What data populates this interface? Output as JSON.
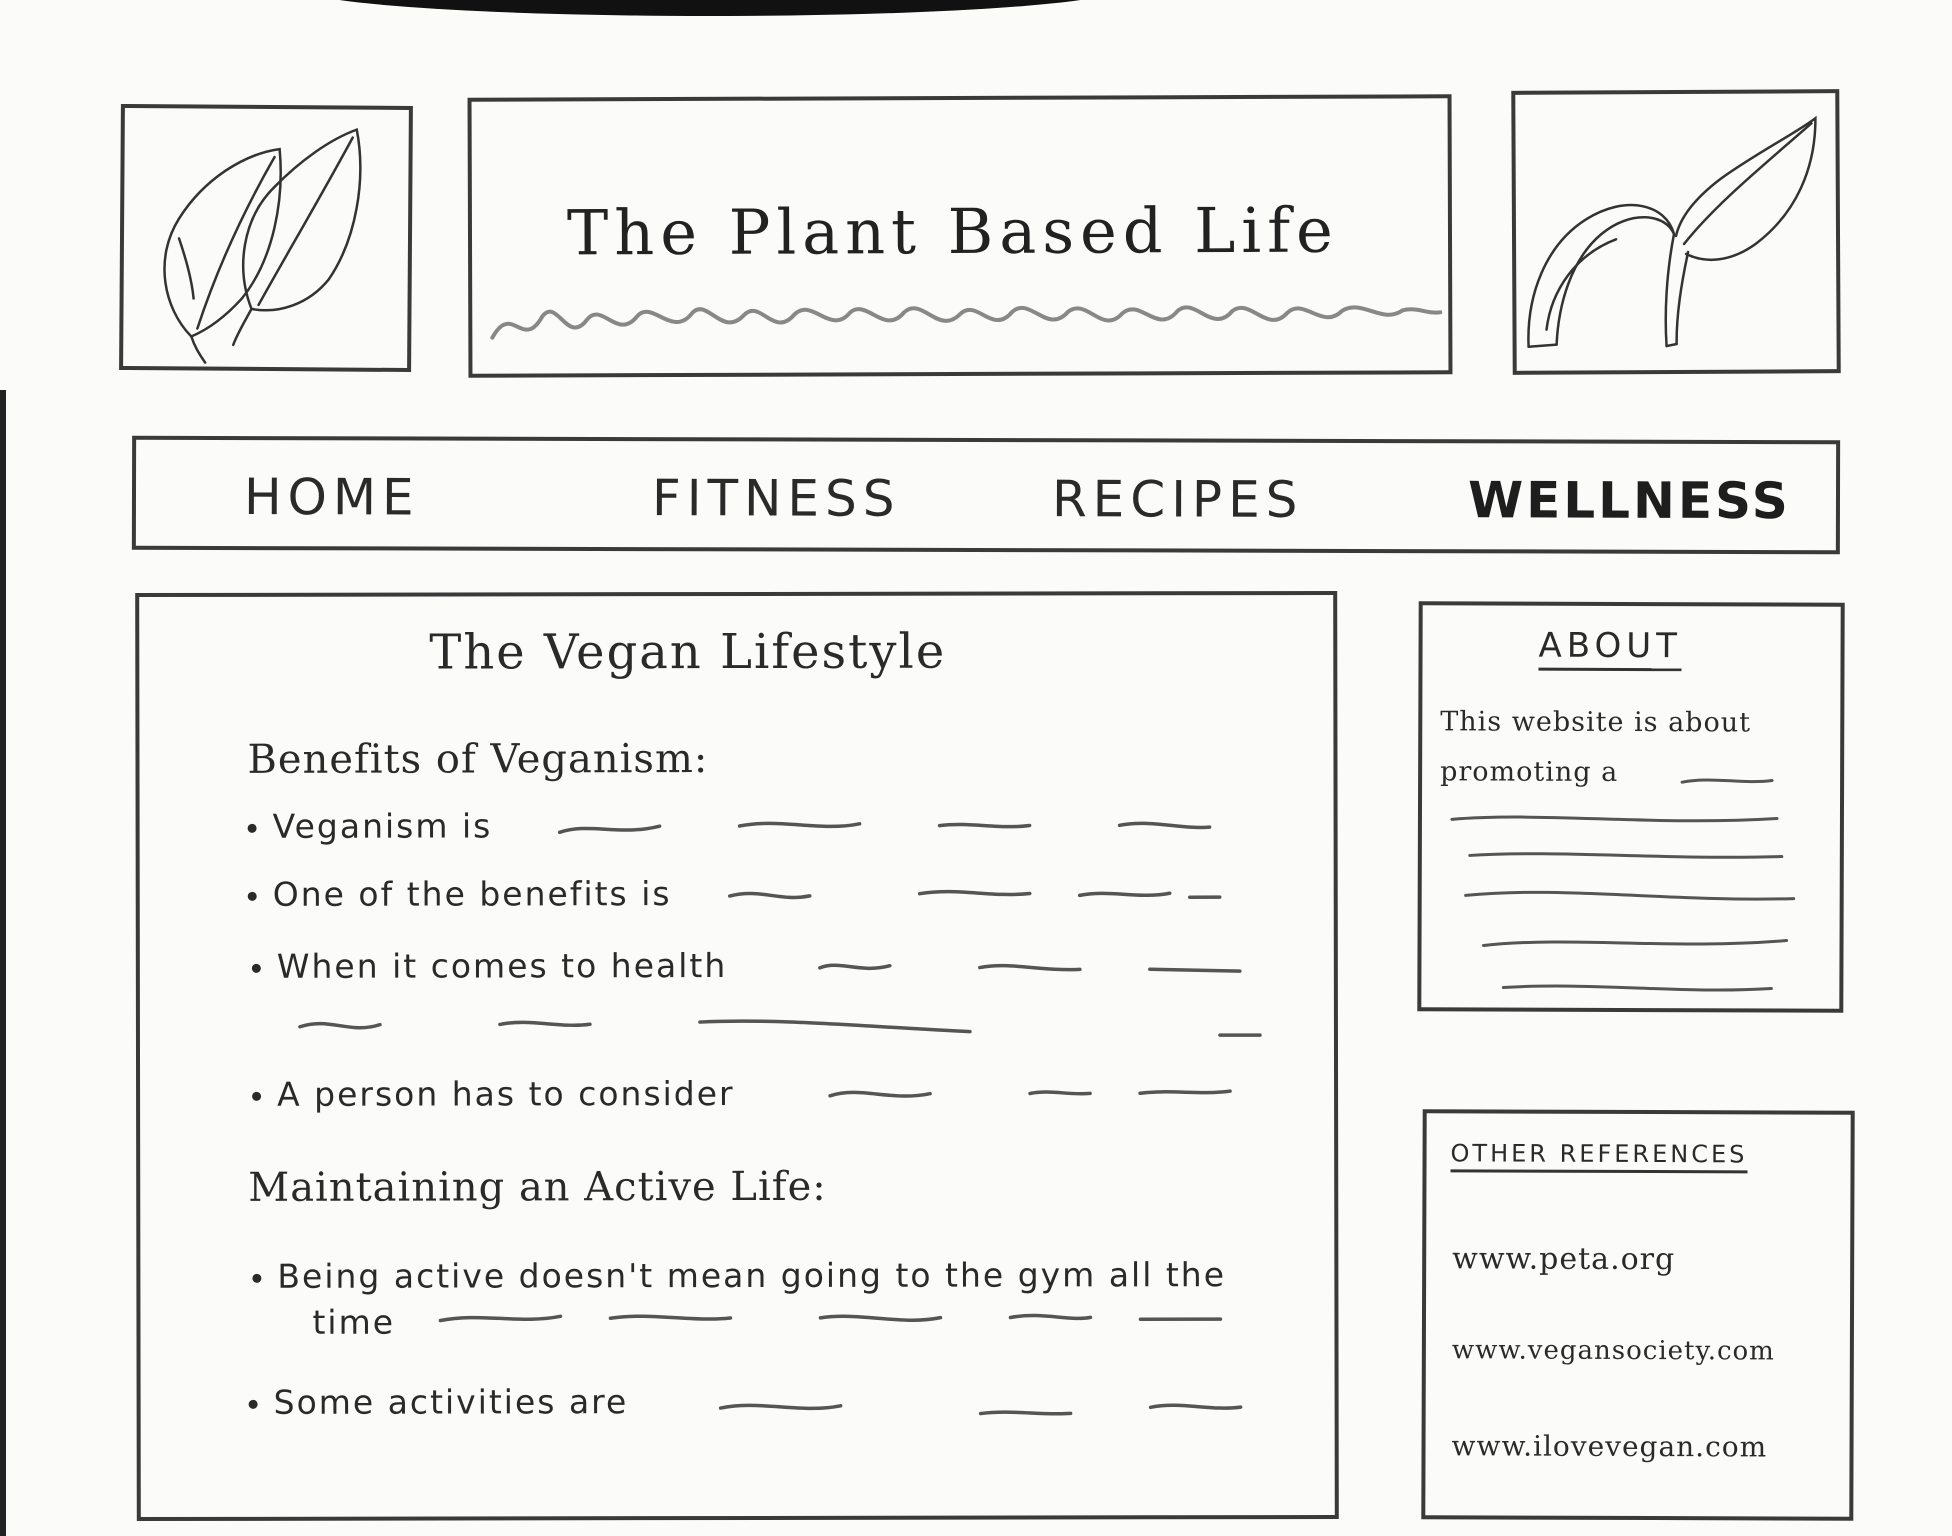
{
  "header": {
    "site_title": "The Plant Based Life"
  },
  "nav": {
    "items": [
      {
        "label": "HOME"
      },
      {
        "label": "FITNESS"
      },
      {
        "label": "RECIPES"
      },
      {
        "label": "WELLNESS"
      }
    ]
  },
  "main": {
    "title": "The Vegan Lifestyle",
    "sections": [
      {
        "heading": "Benefits of Veganism:",
        "bullets": [
          "Veganism is",
          "One of the benefits is",
          "When it comes to health",
          "A person has to consider"
        ]
      },
      {
        "heading": "Maintaining an Active Life:",
        "bullets": [
          "Being active doesn't mean going to the gym all the",
          "time",
          "Some activities are"
        ]
      }
    ]
  },
  "sidebar": {
    "about": {
      "title": "ABOUT",
      "text": "This website is about promoting a"
    },
    "references": {
      "title": "OTHER REFERENCES",
      "links": [
        "www.peta.org",
        "www.vegansociety.com",
        "www.ilovevegan.com"
      ]
    }
  },
  "icons": {
    "left_logo": "two-leaves-icon",
    "right_logo": "sprout-icon"
  }
}
